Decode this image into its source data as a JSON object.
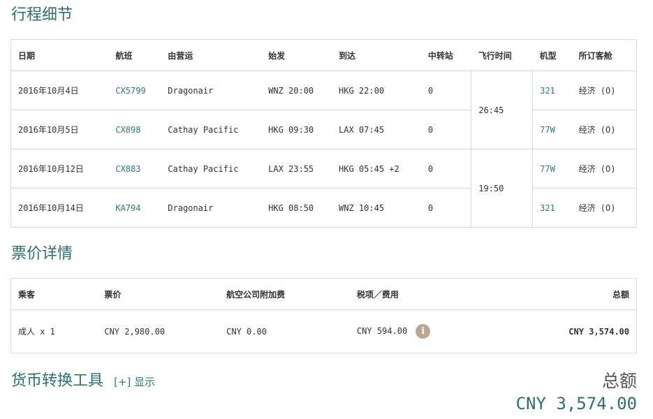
{
  "itinerary": {
    "title": "行程细节",
    "headers": {
      "date": "日期",
      "flight": "航班",
      "operator": "由营运",
      "depart": "始发",
      "arrive": "到达",
      "stops": "中转站",
      "duration": "飞行时间",
      "aircraft": "机型",
      "cabin": "所订客舱"
    },
    "rows": [
      {
        "date": "2016年10月4日",
        "flight": "CX5799",
        "operator": "Dragonair",
        "depart": "WNZ 20:00",
        "arrive": "HKG 22:00",
        "stops": "0",
        "aircraft": "321",
        "cabin": "经济 (O)"
      },
      {
        "date": "2016年10月5日",
        "flight": "CX898",
        "operator": "Cathay Pacific",
        "depart": "HKG 09:30",
        "arrive": "LAX 07:45",
        "stops": "0",
        "aircraft": "77W",
        "cabin": "经济 (O)"
      },
      {
        "date": "2016年10月12日",
        "flight": "CX883",
        "operator": "Cathay Pacific",
        "depart": "LAX 23:55",
        "arrive": "HKG 05:45 +2",
        "stops": "0",
        "aircraft": "77W",
        "cabin": "经济 (O)"
      },
      {
        "date": "2016年10月14日",
        "flight": "KA794",
        "operator": "Dragonair",
        "depart": "HKG 08:50",
        "arrive": "WNZ 10:45",
        "stops": "0",
        "aircraft": "321",
        "cabin": "经济 (O)"
      }
    ],
    "durations": [
      "26:45",
      "19:50"
    ]
  },
  "fare": {
    "title": "票价详情",
    "headers": {
      "passenger": "乘客",
      "fare": "票价",
      "surcharge": "航空公司附加费",
      "taxes": "税项／费用",
      "total": "总额"
    },
    "row": {
      "passenger": "成人 x 1",
      "fare": "CNY 2,980.00",
      "surcharge": "CNY 0.00",
      "taxes": "CNY 594.00",
      "total": "CNY 3,574.00"
    },
    "info_icon": "i"
  },
  "converter": {
    "title": "货币转换工具",
    "toggle_bracket": "[+]",
    "toggle_label": "显示"
  },
  "grand_total": {
    "label": "总额",
    "amount": "CNY 3,574.00"
  },
  "colors": {
    "accent": "#2a6f73",
    "link": "#2a7a80",
    "border": "#d8d8d8",
    "info_icon_bg": "#bba98f"
  }
}
